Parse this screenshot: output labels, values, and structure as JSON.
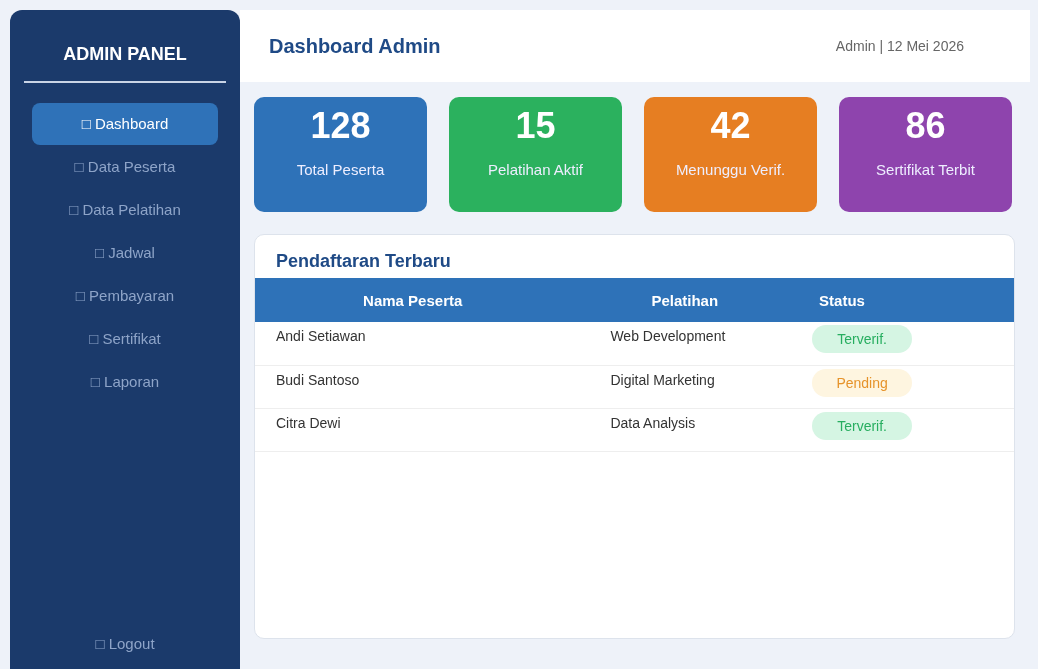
{
  "sidebar": {
    "title": "ADMIN PANEL",
    "items": [
      {
        "label": "□ Dashboard",
        "selected": true
      },
      {
        "label": "□ Data Peserta",
        "selected": false
      },
      {
        "label": "□ Data Pelatihan",
        "selected": false
      },
      {
        "label": "□ Jadwal",
        "selected": false
      },
      {
        "label": "□ Pembayaran",
        "selected": false
      },
      {
        "label": "□ Sertifikat",
        "selected": false
      },
      {
        "label": "□ Laporan",
        "selected": false
      }
    ],
    "logout": "□ Logout"
  },
  "header": {
    "title": "Dashboard Admin",
    "info": "Admin | 12 Mei 2026"
  },
  "stats": [
    {
      "value": "128",
      "label": "Total Peserta",
      "color": "#2e72b8"
    },
    {
      "value": "15",
      "label": "Pelatihan Aktif",
      "color": "#2bb15e"
    },
    {
      "value": "42",
      "label": "Menunggu Verif.",
      "color": "#e67e22"
    },
    {
      "value": "86",
      "label": "Sertifikat Terbit",
      "color": "#8e44ad"
    }
  ],
  "table": {
    "title": "Pendaftaran Terbaru",
    "columns": [
      "Nama Peserta",
      "Pelatihan",
      "Status"
    ],
    "rows": [
      {
        "name": "Andi Setiawan",
        "course": "Web Development",
        "status": {
          "text": "Terverif.",
          "kind": "verified"
        }
      },
      {
        "name": "Budi Santoso",
        "course": "Digital Marketing",
        "status": {
          "text": "Pending",
          "kind": "pending"
        }
      },
      {
        "name": "Citra Dewi",
        "course": "Data Analysis",
        "status": {
          "text": "Terverif.",
          "kind": "verified"
        }
      }
    ]
  }
}
